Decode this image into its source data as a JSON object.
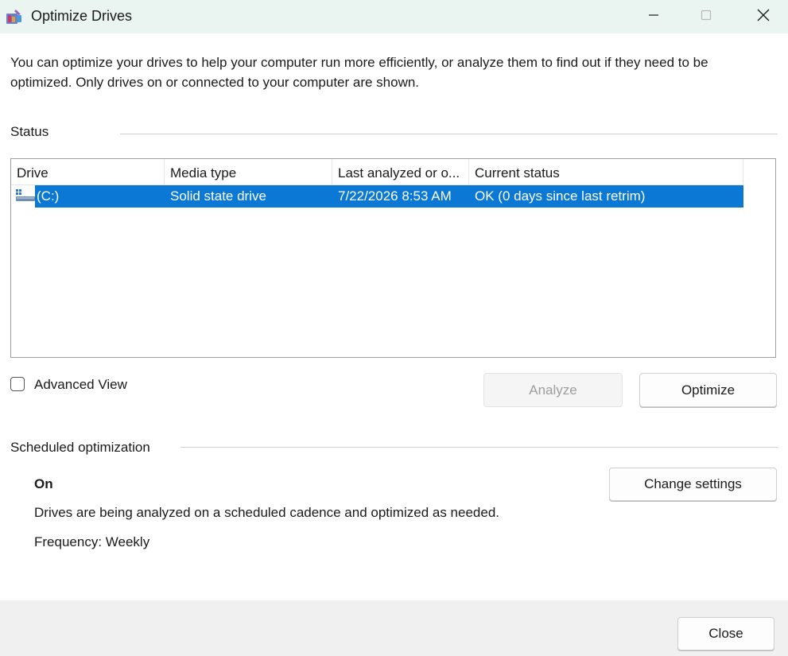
{
  "window": {
    "title": "Optimize Drives",
    "app_icon": "optimize-drives-icon",
    "controls": [
      "minimize-icon",
      "maximize-icon",
      "close-icon"
    ]
  },
  "intro_text": "You can optimize your drives to help your computer run more efficiently, or analyze them to find out if they need to be optimized. Only drives on or connected to your computer are shown.",
  "status": {
    "label": "Status",
    "columns": [
      "Drive",
      "Media type",
      "Last analyzed or o...",
      "Current status"
    ],
    "rows": [
      {
        "icon": "drive-icon",
        "drive": "(C:)",
        "media_type": "Solid state drive",
        "last_analyzed": "7/22/2026 8:53 AM",
        "current_status": "OK (0 days since last retrim)",
        "selected": true
      }
    ]
  },
  "advanced_view": {
    "label": "Advanced View",
    "checked": false
  },
  "buttons": {
    "analyze": "Analyze",
    "optimize": "Optimize",
    "change_settings": "Change settings",
    "close": "Close"
  },
  "scheduled": {
    "label": "Scheduled optimization",
    "state": "On",
    "description": "Drives are being analyzed on a scheduled cadence and optimized as needed.",
    "frequency": "Frequency: Weekly"
  },
  "colors": {
    "titlebar_bg": "#eaf5f1",
    "selection": "#0a78d4",
    "footer_bg": "#f0f0f0"
  }
}
